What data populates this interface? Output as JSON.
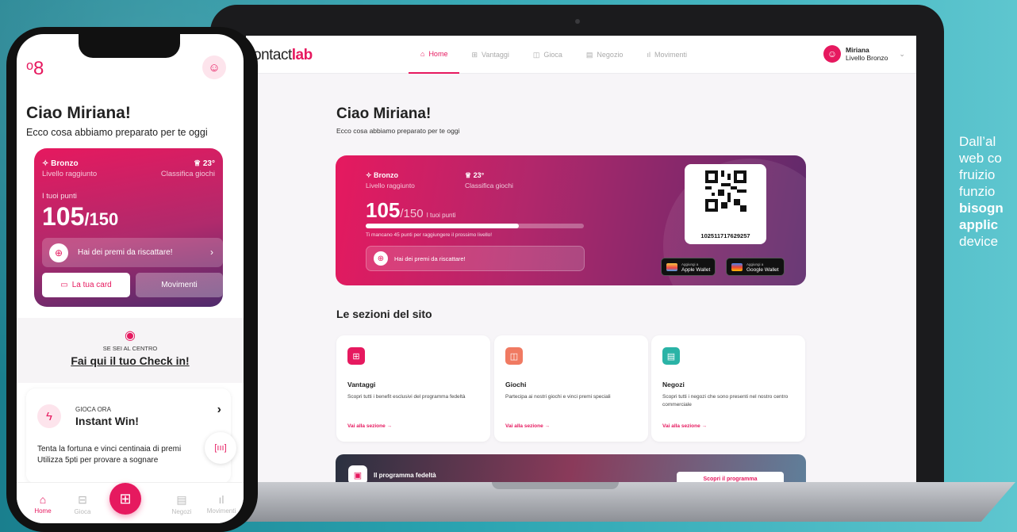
{
  "web": {
    "logo_prefix": "contact",
    "logo_suffix": "lab",
    "nav": [
      {
        "label": "Home",
        "icon": "home-icon"
      },
      {
        "label": "Vantaggi",
        "icon": "gift-icon"
      },
      {
        "label": "Gioca",
        "icon": "gamepad-icon"
      },
      {
        "label": "Negozio",
        "icon": "store-icon"
      },
      {
        "label": "Movimenti",
        "icon": "chart-icon"
      }
    ],
    "user_name": "Miriana",
    "user_level": "Livello Bronzo",
    "greeting": "Ciao Miriana!",
    "subtitle": "Ecco cosa abbiamo preparato per te oggi",
    "card": {
      "level": "Bronzo",
      "level_caption": "Livello raggiunto",
      "rank": "23°",
      "rank_caption": "Classifica giochi",
      "points": "105",
      "points_total": "/150",
      "points_label": "I tuoi punti",
      "progress": 0.7,
      "missing_text": "Ti mancano 45 punti per raggiungere il prossimo livello!",
      "prize_text": "Hai dei premi da riscattare!",
      "qr_code": "102511717629257",
      "apple_top": "Aggiungi a",
      "apple_label": "Apple Wallet",
      "google_top": "Aggiungi a",
      "google_label": "Google Wallet"
    },
    "sections_title": "Le sezioni del sito",
    "sections": [
      {
        "title": "Vantaggi",
        "desc": "Scopri tutti i benefit esclusivi del programma fedeltà",
        "link": "Vai alla sezione →",
        "color": "#e6195f"
      },
      {
        "title": "Giochi",
        "desc": "Partecipa ai nostri giochi e vinci premi speciali",
        "link": "Vai alla sezione →",
        "color": "#f07a62"
      },
      {
        "title": "Negozi",
        "desc": "Scopri tutti i negozi che sono presenti nel nostro centro commerciale",
        "link": "Vai alla sezione →",
        "color": "#2ab3a6"
      }
    ],
    "fidelity_title": "Il programma fedeltà",
    "fidelity_button": "Scopri il programma"
  },
  "phone": {
    "greeting": "Ciao Miriana!",
    "subtitle": "Ecco cosa abbiamo preparato per te oggi",
    "level": "Bronzo",
    "level_caption": "Livello raggiunto",
    "rank": "23°",
    "rank_caption": "Classifica giochi",
    "points_label": "I tuoi punti",
    "points": "105",
    "points_total": "/150",
    "prize_text": "Hai dei premi da riscattare!",
    "card_button": "La tua card",
    "movements_button": "Movimenti",
    "checkin_caption": "SE SEI AL CENTRO",
    "checkin_text": "Fai qui il tuo Check in!",
    "game_caption": "GIOCA ORA",
    "game_title": "Instant Win!",
    "game_desc_1": "Tenta la fortuna e vinci centinaia di premi",
    "game_desc_2": "Utilizza 5pti per provare a sognare",
    "tabs": [
      {
        "label": "Home",
        "icon": "home-icon"
      },
      {
        "label": "Gioca",
        "icon": "ticket-icon"
      },
      {
        "label": "Negozi",
        "icon": "store-icon"
      },
      {
        "label": "Movimenti",
        "icon": "chart-icon"
      }
    ]
  },
  "side": {
    "line1": "Dall’al",
    "line2": "web co",
    "line3": "fruizio",
    "line4": "funzio",
    "line5": "bisogn",
    "line6": "applic",
    "line7": "device"
  },
  "colors": {
    "accent": "#e6195f",
    "teal": "#2aa3b0"
  }
}
